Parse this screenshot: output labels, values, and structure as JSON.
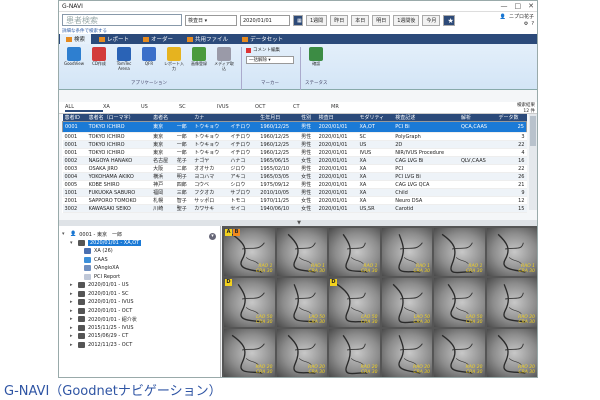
{
  "app_title": "G-NAVI",
  "window_controls": {
    "minimize": "—",
    "maximize": "□",
    "close": "✕"
  },
  "search": {
    "value": "患者検索"
  },
  "toolbar": {
    "date_field_label": "検査日",
    "date_value": "2020/01/01",
    "calendar_icon": "calendar-icon",
    "buttons": [
      "1週間",
      "昨日",
      "本日",
      "明日",
      "1週間後",
      "今月"
    ]
  },
  "user": {
    "name": "ニプロ花子",
    "gear_label": "⚙",
    "help_label": "?"
  },
  "hint_link": "詳細な条件で検索する",
  "ribbon": {
    "tabs": [
      "検索",
      "レポート",
      "オーダー",
      "共用ファイル",
      "データセット"
    ],
    "groups": [
      {
        "label": "アプリケーション",
        "tools": [
          {
            "label": "GoodView",
            "color": "#2e7fd0"
          },
          {
            "label": "CD作成",
            "color": "#d33b3b"
          },
          {
            "label": "TomTec Arena",
            "color": "#2a63b6"
          },
          {
            "label": "QFR",
            "color": "#3b6fc9"
          },
          {
            "label": "レポート入力",
            "color": "#e6b31f"
          },
          {
            "label": "画像登録",
            "color": "#4a9a3d"
          },
          {
            "label": "メディア取込",
            "color": "#9a9aa8"
          }
        ]
      },
      {
        "label": "マーカー",
        "marker_label": "コメント編集",
        "select_label": "一括解除"
      },
      {
        "label": "ステータス",
        "tools": [
          {
            "label": "確認",
            "color": "#3c8c44"
          }
        ]
      }
    ]
  },
  "filter_tabs": [
    "ALL",
    "XA",
    "US",
    "SC",
    "IVUS",
    "OCT",
    "CT",
    "MR"
  ],
  "result_count_label": "検索結果",
  "result_count": "12 件",
  "table": {
    "headers": [
      "患者ID",
      "患者名（ローマ字）",
      "患者名",
      "",
      "カナ",
      "",
      "生年月日",
      "性別",
      "検査日",
      "モダリティ",
      "検査記述",
      "解析",
      "データ数"
    ],
    "rows": [
      [
        "0001",
        "TOKYO ICHIRO",
        "東京",
        "一郎",
        "トウキョウ",
        "イチロウ",
        "1960/12/25",
        "男性",
        "2020/01/01",
        "XA,OT",
        "PCI Bi",
        "QCA,CAAS",
        "25"
      ],
      [
        "0001",
        "TOKYO ICHIRO",
        "東京",
        "一郎",
        "トウキョウ",
        "イチロウ",
        "1960/12/25",
        "男性",
        "2020/01/01",
        "SC",
        "PolyGraph",
        "",
        "3"
      ],
      [
        "0001",
        "TOKYO ICHIRO",
        "東京",
        "一郎",
        "トウキョウ",
        "イチロウ",
        "1960/12/25",
        "男性",
        "2020/01/01",
        "US",
        "2D",
        "",
        "22"
      ],
      [
        "0001",
        "TOKYO ICHIRO",
        "東京",
        "一郎",
        "トウキョウ",
        "イチロウ",
        "1960/12/25",
        "男性",
        "2020/01/01",
        "IVUS",
        "NIR/IVUS Procedure",
        "",
        "4"
      ],
      [
        "0002",
        "NAGOYA HANAKO",
        "名古屋",
        "花子",
        "ナゴヤ",
        "ハナコ",
        "1965/06/15",
        "女性",
        "2020/01/01",
        "XA",
        "CAG LVG Bi",
        "QLV,CAAS",
        "16"
      ],
      [
        "0003",
        "OSAKA JIRO",
        "大阪",
        "二郎",
        "オオサカ",
        "ジロウ",
        "1955/02/10",
        "男性",
        "2020/01/01",
        "XA",
        "PCI",
        "",
        "22"
      ],
      [
        "0004",
        "YOKOHAMA AKIKO",
        "横浜",
        "明子",
        "ヨコハマ",
        "アキコ",
        "1965/03/05",
        "女性",
        "2020/01/01",
        "XA",
        "PCI LVG Bi",
        "",
        "26"
      ],
      [
        "0005",
        "KOBE SHIRO",
        "神戸",
        "四郎",
        "コウベ",
        "シロウ",
        "1975/09/12",
        "男性",
        "2020/01/01",
        "XA",
        "CAG LVG QCA",
        "",
        "21"
      ],
      [
        "1001",
        "FUKUOKA SABURO",
        "福岡",
        "三郎",
        "フクオカ",
        "サブロウ",
        "2010/10/05",
        "男性",
        "2020/01/01",
        "XA",
        "Child",
        "",
        "9"
      ],
      [
        "2001",
        "SAPPORO TOMOKO",
        "札幌",
        "智子",
        "サッポロ",
        "トモコ",
        "1970/11/25",
        "女性",
        "2020/01/01",
        "XA",
        "Neuro DSA",
        "",
        "12"
      ],
      [
        "3002",
        "KAWASAKI SEIKO",
        "川崎",
        "聖子",
        "カワサキ",
        "セイコ",
        "1940/06/10",
        "女性",
        "2020/01/01",
        "US,SR",
        "Carotid",
        "",
        "15"
      ]
    ]
  },
  "splitter_arrow": "▼",
  "tree": {
    "root": "0001 - 東京　一郎",
    "collapse_glyph": "▾",
    "selected_study": "2020/01/01 - XA,OT",
    "children": [
      "XA (26)",
      "CAAS",
      "QAngioXA",
      "PCI Report"
    ],
    "other_studies": [
      "2020/01/01 - US",
      "2020/01/01 - SC",
      "2020/01/01 - IVUS",
      "2020/01/01 - OCT",
      "2020/01/01 - 紹介状",
      "2015/11/25 - IVUS",
      "2015/06/29 - CT",
      "2012/11/23 - OCT"
    ]
  },
  "viewer": {
    "cells": [
      {
        "tag": "A",
        "tag2": "B",
        "ann": "RAO 1\nCRA 30"
      },
      {
        "tag": "",
        "ann": "RAO 1\nCRA 30"
      },
      {
        "tag": "",
        "ann": "RAO 1\nCRA 30"
      },
      {
        "tag": "",
        "ann": "RAO 1\nCRA 30"
      },
      {
        "tag": "",
        "ann": "RAO 1\nCRA 30"
      },
      {
        "tag": "",
        "ann": "RAO 1\nCRA 30"
      },
      {
        "tag": "D",
        "ann": "LAO 50\nCRA 30"
      },
      {
        "tag": "",
        "ann": "LAO 50\nCRA 30"
      },
      {
        "tag": "D",
        "ann": "LAO 50\nCRA 30"
      },
      {
        "tag": "",
        "ann": "LAO 50\nCRA 30"
      },
      {
        "tag": "",
        "ann": "LAO 50\nCRA 30"
      },
      {
        "tag": "",
        "ann": "RAO 20\nCRA 30"
      },
      {
        "tag": "",
        "ann": "RAO 20\nCRA 30"
      },
      {
        "tag": "",
        "ann": "RAO 20\nCRA 30"
      },
      {
        "tag": "",
        "ann": "RAO 20\nCRA 30"
      },
      {
        "tag": "",
        "ann": "RAO 20\nCRA 30"
      },
      {
        "tag": "",
        "ann": "RAO 20\nCRA 30"
      },
      {
        "tag": "",
        "ann": "RAO 20\nCRA 30"
      }
    ]
  },
  "caption": "G-NAVI（Goodnetナビゲーション）"
}
